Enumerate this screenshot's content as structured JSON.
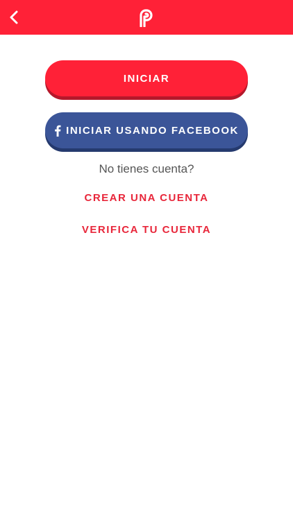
{
  "header": {
    "back_icon": "chevron-left-icon",
    "logo_icon": "parler-p-logo",
    "background_color": "#ff2137"
  },
  "actions": {
    "login_label": "INICIAR",
    "facebook_label": "INICIAR USANDO FACEBOOK",
    "facebook_icon": "facebook-f-icon"
  },
  "signup": {
    "prompt": "No tienes cuenta?",
    "create_account_label": "CREAR UNA CUENTA",
    "verify_account_label": "VERIFICA TU CUENTA"
  },
  "colors": {
    "accent_red": "#ff2137",
    "facebook_blue": "#3b5598",
    "link_red": "#e8263a"
  }
}
